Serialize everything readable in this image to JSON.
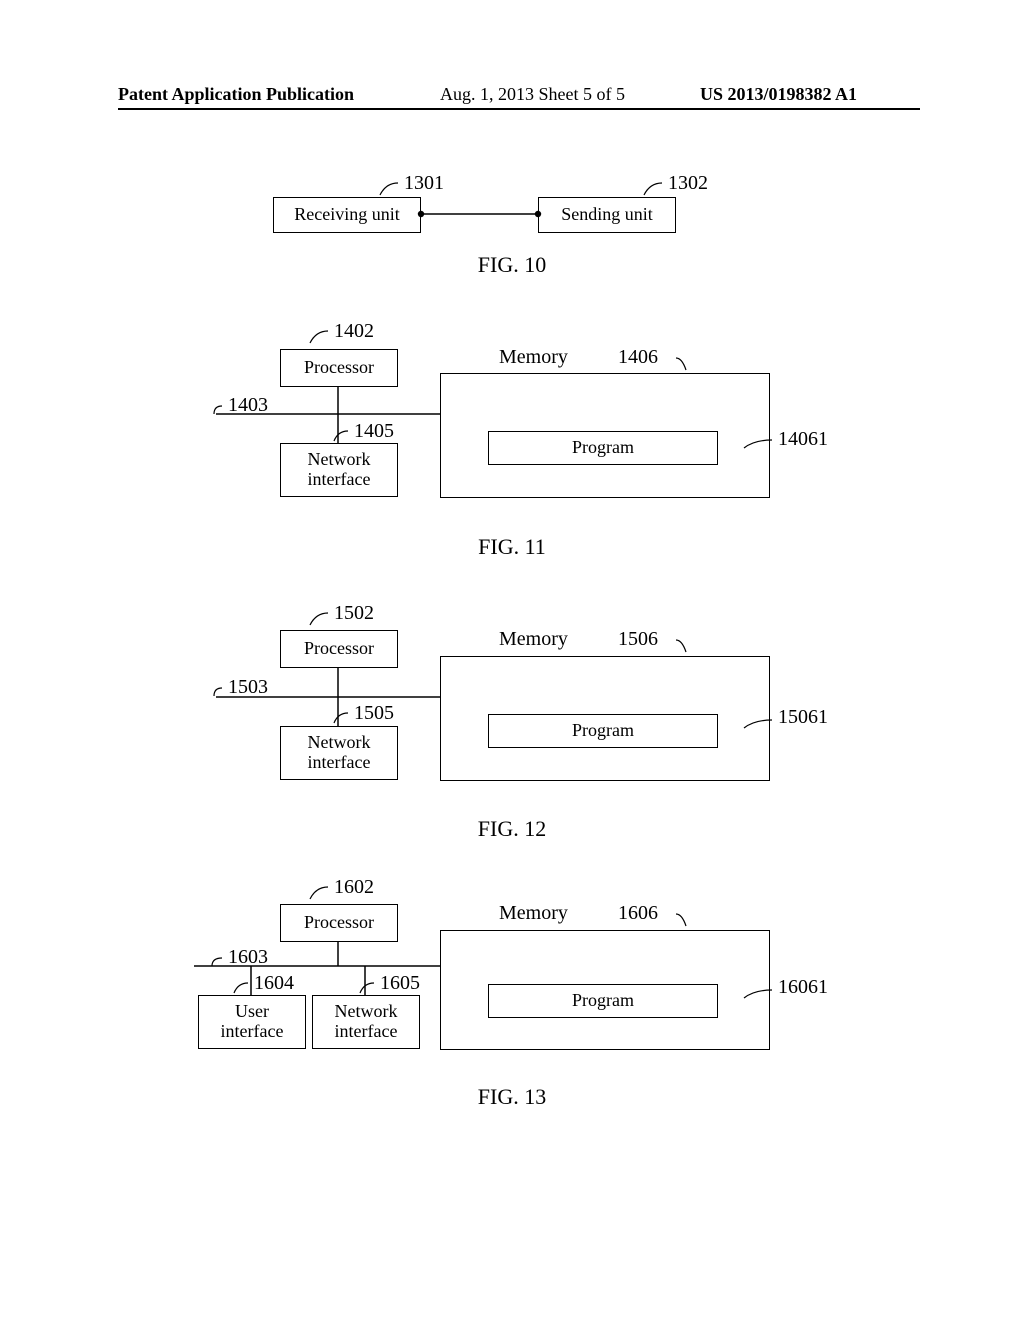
{
  "header": {
    "left": "Patent Application Publication",
    "mid": "Aug. 1, 2013   Sheet 5 of 5",
    "right": "US 2013/0198382 A1"
  },
  "fig10": {
    "caption": "FIG. 10",
    "receiving": "Receiving unit",
    "sending": "Sending unit",
    "ref1": "1301",
    "ref2": "1302"
  },
  "fig11": {
    "caption": "FIG. 11",
    "processor": "Processor",
    "network": "Network\ninterface",
    "memory": "Memory",
    "program": "Program",
    "ref_proc": "1402",
    "ref_bus": "1403",
    "ref_net": "1405",
    "ref_mem": "1406",
    "ref_prog": "14061"
  },
  "fig12": {
    "caption": "FIG. 12",
    "processor": "Processor",
    "network": "Network\ninterface",
    "memory": "Memory",
    "program": "Program",
    "ref_proc": "1502",
    "ref_bus": "1503",
    "ref_net": "1505",
    "ref_mem": "1506",
    "ref_prog": "15061"
  },
  "fig13": {
    "caption": "FIG. 13",
    "processor": "Processor",
    "user": "User\ninterface",
    "network": "Network\ninterface",
    "memory": "Memory",
    "program": "Program",
    "ref_proc": "1602",
    "ref_bus": "1603",
    "ref_user": "1604",
    "ref_net": "1605",
    "ref_mem": "1606",
    "ref_prog": "16061"
  }
}
